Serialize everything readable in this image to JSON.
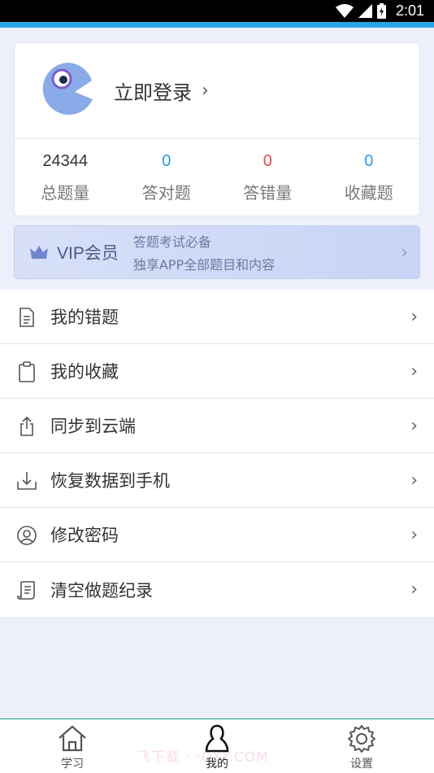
{
  "status_bar": {
    "time": "2:01"
  },
  "profile": {
    "login_text": "立即登录",
    "stats": [
      {
        "value": "24344",
        "label": "总题量",
        "color": "#333333"
      },
      {
        "value": "0",
        "label": "答对题",
        "color": "#2a9be0"
      },
      {
        "value": "0",
        "label": "答错量",
        "color": "#e8484a"
      },
      {
        "value": "0",
        "label": "收藏题",
        "color": "#2a9be0"
      }
    ]
  },
  "vip": {
    "title": "VIP会员",
    "line1": "答题考试必备",
    "line2": "独享APP全部题目和内容"
  },
  "menu": [
    {
      "label": "我的错题",
      "icon": "document-icon"
    },
    {
      "label": "我的收藏",
      "icon": "clipboard-icon"
    },
    {
      "label": "同步到云端",
      "icon": "upload-icon"
    },
    {
      "label": "恢复数据到手机",
      "icon": "download-icon"
    },
    {
      "label": "修改密码",
      "icon": "user-circle-icon"
    },
    {
      "label": "清空做题纪录",
      "icon": "scroll-icon"
    }
  ],
  "tabbar": [
    {
      "label": "学习",
      "icon": "home-icon",
      "active": false
    },
    {
      "label": "我的",
      "icon": "person-icon",
      "active": true
    },
    {
      "label": "设置",
      "icon": "gear-icon",
      "active": false
    }
  ],
  "watermark": "飞下载 · ·OXY.COM"
}
